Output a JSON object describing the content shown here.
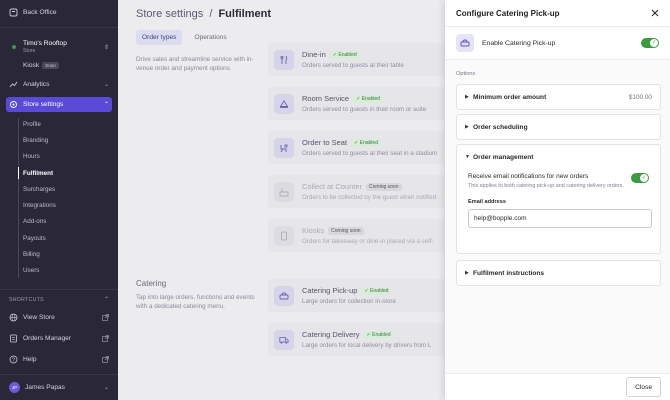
{
  "sidebar": {
    "app_name": "Back Office",
    "store_name": "Timo's Rooftop",
    "store_sub": "Store",
    "kiosk_label": "Kiosk",
    "kiosk_badge": "Soon",
    "analytics_label": "Analytics",
    "store_settings_label": "Store settings",
    "sub_items": [
      "Profile",
      "Branding",
      "Hours",
      "Fulfilment",
      "Surcharges",
      "Integrations",
      "Add-ons",
      "Payouts",
      "Billing",
      "Users"
    ],
    "shortcuts_label": "SHORTCUTS",
    "shortcuts": [
      {
        "label": "View Store",
        "icon": "globe-icon"
      },
      {
        "label": "Orders Manager",
        "icon": "orders-icon"
      },
      {
        "label": "Help",
        "icon": "help-icon"
      }
    ],
    "user_initials": "JP",
    "user_name": "James Papas"
  },
  "main": {
    "breadcrumb_parent": "Store settings",
    "breadcrumb_sep": "/",
    "breadcrumb_current": "Fulfilment",
    "tabs": [
      "Order types",
      "Operations"
    ],
    "in_venue_desc": "Drive sales and streamline service with in-venue order and payment options.",
    "catering_title": "Catering",
    "catering_desc": "Tap into large orders, functions and events with a dedicated catering menu.",
    "order_types": [
      {
        "name": "Dine-in",
        "badge": "Enabled",
        "desc": "Orders served to guests at their table"
      },
      {
        "name": "Room Service",
        "badge": "Enabled",
        "desc": "Orders served to guests in their room or suite"
      },
      {
        "name": "Order to Seat",
        "badge": "Enabled",
        "desc": "Orders served to guests at their seat in a stadium"
      },
      {
        "name": "Collect at Counter",
        "badge": "Coming soon",
        "desc": "Orders to be collected by the guest when notified"
      },
      {
        "name": "Kiosks",
        "badge": "Coming soon",
        "desc": "Orders for takeaway or dine-in placed via a self-"
      }
    ],
    "catering_types": [
      {
        "name": "Catering Pick-up",
        "badge": "Enabled",
        "desc": "Large orders for collection in-store"
      },
      {
        "name": "Catering Delivery",
        "badge": "Enabled",
        "desc": "Large orders for local delivery by drivers from L"
      }
    ]
  },
  "drawer": {
    "title": "Configure Catering Pick-up",
    "enable_label": "Enable Catering Pick-up",
    "enable_on": true,
    "options_label": "Options",
    "min_order_title": "Minimum order amount",
    "min_order_value": "$100.00",
    "scheduling_title": "Order scheduling",
    "management_title": "Order management",
    "notify_title": "Receive email notifications for new orders",
    "notify_sub": "This applies to both catering pick-up and catering delivery orders.",
    "notify_on": true,
    "email_label": "Email address",
    "email_value": "help@bopple.com",
    "instructions_title": "Fulfilment instructions",
    "close_label": "Close"
  },
  "colors": {
    "accent": "#5a4ad6",
    "toggle_on": "#3a9b3f",
    "sidebar_bg": "#2a2838"
  }
}
